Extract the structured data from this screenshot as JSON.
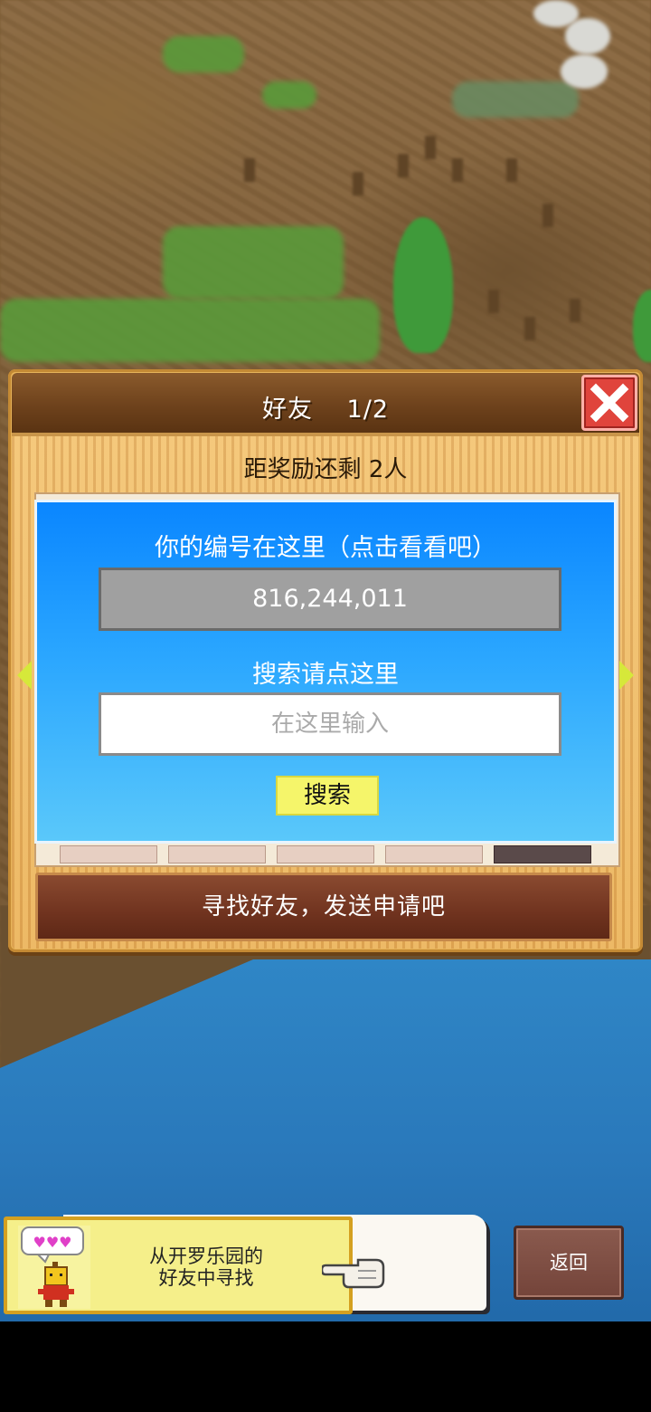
{
  "dialog": {
    "title": "好友　 1/2",
    "reward_text": "距奖励还剩 2人",
    "find_friends_button": "寻找好友，发送申请吧"
  },
  "id_panel": {
    "id_label": "你的编号在这里（点击看看吧）",
    "id_value": "816,244,011",
    "search_label": "搜索请点这里",
    "search_placeholder": "在这里输入",
    "search_button": "搜索"
  },
  "bottom": {
    "kairo_text_line1": "从开罗乐园的",
    "kairo_text_line2": "好友中寻找",
    "back_button": "返回"
  },
  "colors": {
    "overlay_blue": "#0a86ff",
    "close_red": "#e0443c",
    "search_button_yellow": "#f5f56a"
  },
  "icons": [
    "close-icon",
    "arrow-left-icon",
    "arrow-right-icon",
    "mascot-icon",
    "pointing-hand-icon"
  ]
}
